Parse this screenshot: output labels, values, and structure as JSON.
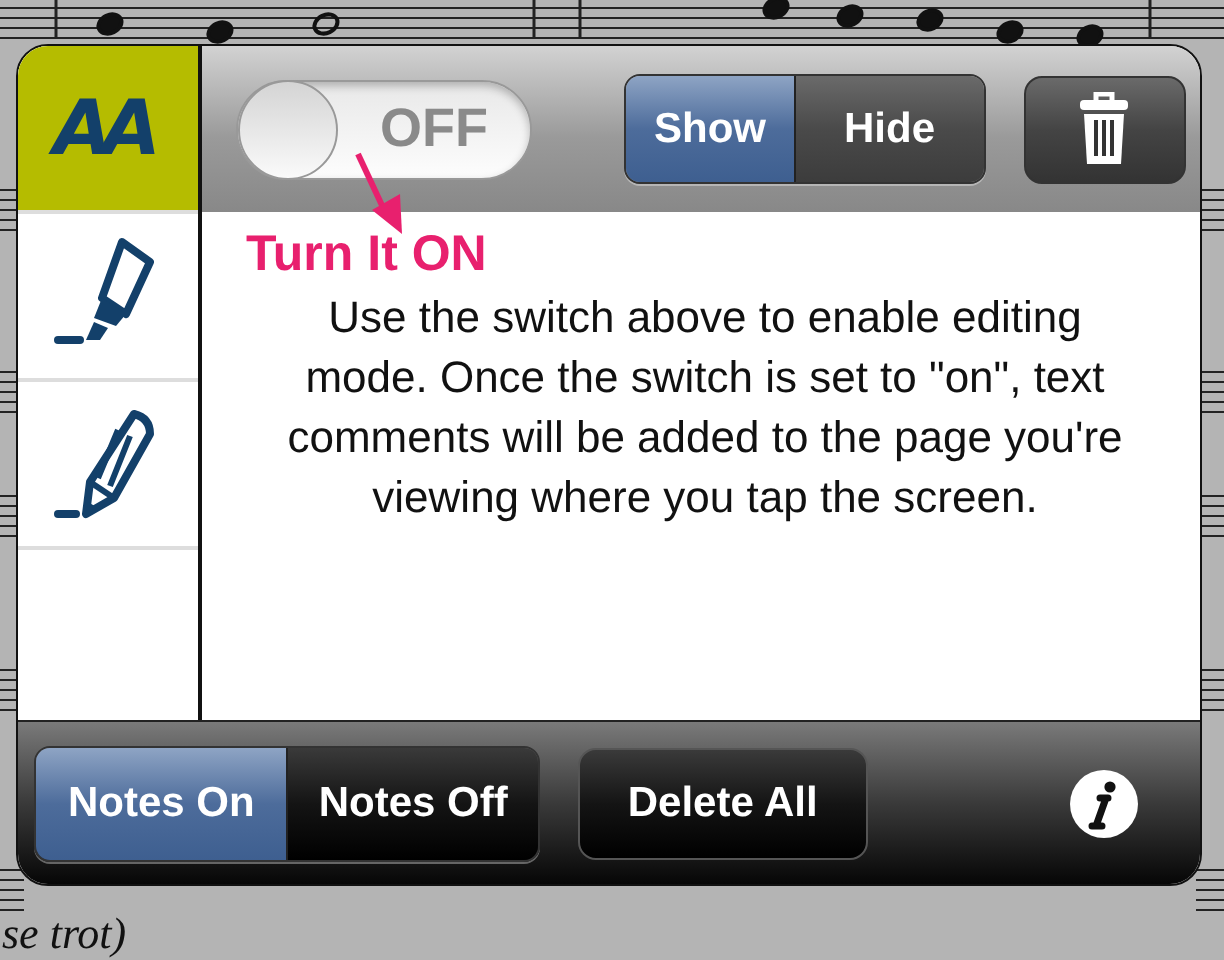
{
  "tools": [
    {
      "kind": "font",
      "label": "AA",
      "selected": true
    },
    {
      "kind": "highlighter",
      "selected": false
    },
    {
      "kind": "pencil",
      "selected": false
    }
  ],
  "editing_switch": {
    "on": false,
    "label": "OFF"
  },
  "visibility": [
    {
      "label": "Show",
      "selected": true
    },
    {
      "label": "Hide",
      "selected": false
    }
  ],
  "annotation": {
    "label": "Turn It ON"
  },
  "instructions": "Use the switch above to enable editing mode. Once the switch is set to \"on\", text comments will be added to the page you're viewing where you tap the screen.",
  "notes": [
    {
      "label": "Notes On",
      "selected": true
    },
    {
      "label": "Notes Off",
      "selected": false
    }
  ],
  "delete_all": {
    "label": "Delete All"
  },
  "page_caption": "se trot)"
}
